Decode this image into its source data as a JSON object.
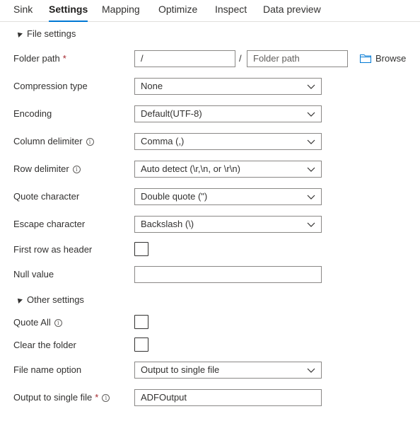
{
  "tabs": [
    "Sink",
    "Settings",
    "Mapping",
    "Optimize",
    "Inspect",
    "Data preview"
  ],
  "active_tab": "Settings",
  "sections": {
    "file_settings": "File settings",
    "other_settings": "Other settings"
  },
  "folder_path": {
    "label": "Folder path",
    "required_mark": "*",
    "container_value": "/",
    "separator": "/",
    "directory_placeholder": "Folder path",
    "browse_label": "Browse"
  },
  "compression_type": {
    "label": "Compression type",
    "value": "None"
  },
  "encoding": {
    "label": "Encoding",
    "value": "Default(UTF-8)"
  },
  "column_delimiter": {
    "label": "Column delimiter",
    "value": "Comma (,)"
  },
  "row_delimiter": {
    "label": "Row delimiter",
    "value": "Auto detect (\\r,\\n, or \\r\\n)"
  },
  "quote_character": {
    "label": "Quote character",
    "value": "Double quote (\")"
  },
  "escape_character": {
    "label": "Escape character",
    "value": "Backslash (\\)"
  },
  "first_row_as_header": {
    "label": "First row as header",
    "checked": false
  },
  "null_value": {
    "label": "Null value",
    "value": ""
  },
  "quote_all": {
    "label": "Quote All",
    "checked": false
  },
  "clear_folder": {
    "label": "Clear the folder",
    "checked": false
  },
  "file_name_option": {
    "label": "File name option",
    "value": "Output to single file"
  },
  "output_single_file": {
    "label": "Output to single file",
    "required_mark": "*",
    "value": "ADFOutput"
  },
  "icons": {
    "info": "info-icon",
    "chevron": "chevron-down-icon",
    "folder": "folder-icon",
    "collapse": "collapse-triangle-icon"
  },
  "colors": {
    "accent": "#0078d4",
    "required": "#a4262c",
    "border": "#8a8886"
  }
}
